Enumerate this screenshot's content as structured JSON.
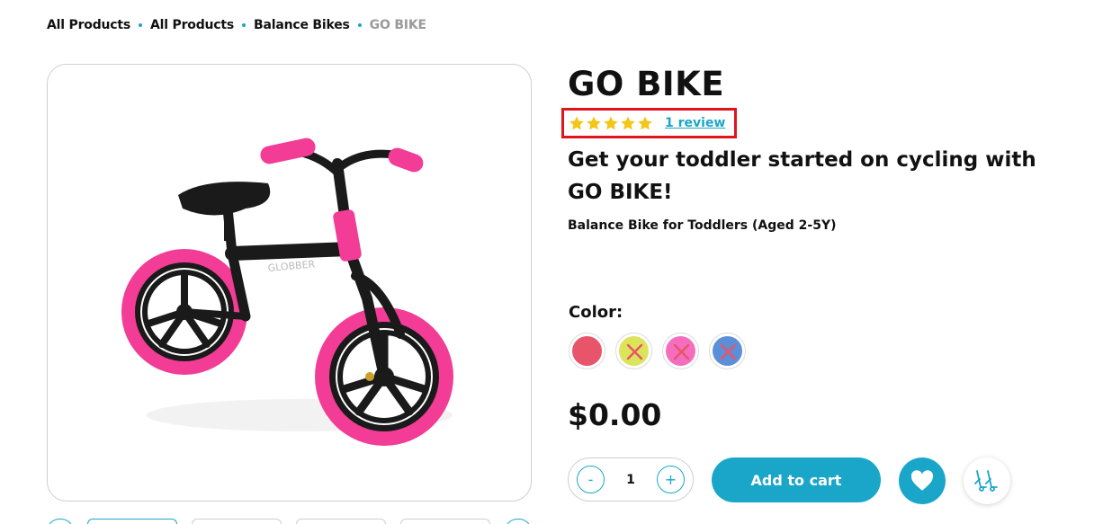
{
  "breadcrumb": {
    "items": [
      "All Products",
      "All Products",
      "Balance Bikes"
    ],
    "current": "GO BIKE"
  },
  "product": {
    "title": "GO BIKE",
    "rating": {
      "stars": 5,
      "max": 5,
      "review_link": "1 review"
    },
    "tagline": "Get your toddler started on cycling with GO BIKE!",
    "subtitle": "Balance Bike for Toddlers (Aged 2-5Y)",
    "color_label": "Color:",
    "colors": [
      {
        "name": "red",
        "hex": "#e8546a",
        "unavailable": true
      },
      {
        "name": "lime",
        "hex": "#dbe45a",
        "unavailable": true
      },
      {
        "name": "pink",
        "hex": "#f56ebd",
        "unavailable": true
      },
      {
        "name": "blue",
        "hex": "#5b8fd8",
        "unavailable": true
      }
    ],
    "price": "$0.00",
    "quantity": {
      "value": "1",
      "minus": "-",
      "plus": "+"
    },
    "add_to_cart": "Add to cart"
  },
  "icons": {
    "wishlist": "heart-icon",
    "compare": "compare-icon"
  },
  "colors": {
    "accent": "#1aa6c9",
    "highlight_border": "#e0151b",
    "star": "#f5c518",
    "bike_tire": "#f23c96"
  }
}
